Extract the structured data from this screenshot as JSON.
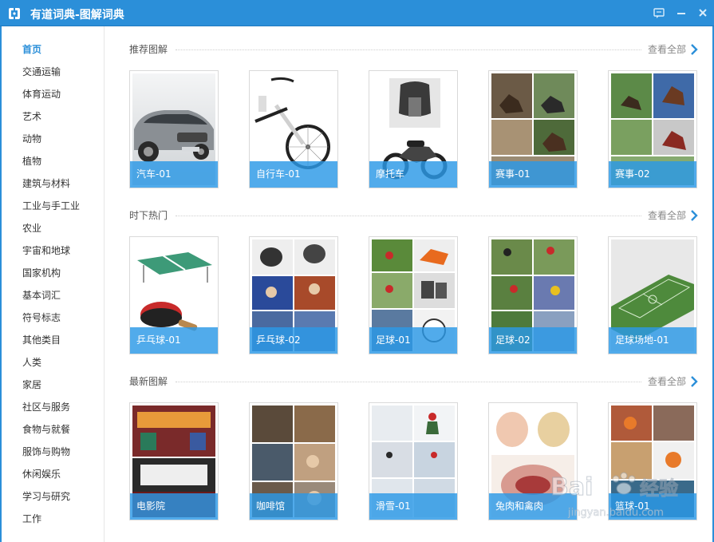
{
  "window": {
    "title": "有道词典-图解词典",
    "logo_icon": "youdao-logo-icon",
    "buttons": [
      "feedback-icon",
      "minimize-icon",
      "close-icon"
    ]
  },
  "sidebar": {
    "items": [
      {
        "label": "首页",
        "active": true
      },
      {
        "label": "交通运输"
      },
      {
        "label": "体育运动"
      },
      {
        "label": "艺术"
      },
      {
        "label": "动物"
      },
      {
        "label": "植物"
      },
      {
        "label": "建筑与材料"
      },
      {
        "label": "工业与手工业"
      },
      {
        "label": "农业"
      },
      {
        "label": "宇宙和地球"
      },
      {
        "label": "国家机构"
      },
      {
        "label": "基本词汇"
      },
      {
        "label": "符号标志"
      },
      {
        "label": "其他类目"
      },
      {
        "label": "人类"
      },
      {
        "label": "家居"
      },
      {
        "label": "社区与服务"
      },
      {
        "label": "食物与就餐"
      },
      {
        "label": "服饰与购物"
      },
      {
        "label": "休闲娱乐"
      },
      {
        "label": "学习与研究"
      },
      {
        "label": "工作"
      }
    ]
  },
  "sections": [
    {
      "title": "推荐图解",
      "view_all": "查看全部",
      "cards": [
        {
          "label": "汽车-01"
        },
        {
          "label": "自行车-01"
        },
        {
          "label": "摩托车"
        },
        {
          "label": "赛事-01"
        },
        {
          "label": "赛事-02"
        }
      ]
    },
    {
      "title": "时下热门",
      "view_all": "查看全部",
      "cards": [
        {
          "label": "乒乓球-01"
        },
        {
          "label": "乒乓球-02"
        },
        {
          "label": "足球-01"
        },
        {
          "label": "足球-02"
        },
        {
          "label": "足球场地-01"
        }
      ]
    },
    {
      "title": "最新图解",
      "view_all": "查看全部",
      "cards": [
        {
          "label": "电影院"
        },
        {
          "label": "咖啡馆"
        },
        {
          "label": "滑雪-01"
        },
        {
          "label": "兔肉和禽肉"
        },
        {
          "label": "篮球-01"
        }
      ]
    }
  ],
  "watermark": {
    "brand": "Bai",
    "brand_suffix": "经验",
    "url": "jingyan.baidu.com"
  },
  "colors": {
    "accent": "#2b8fd9",
    "caption_bg": "#2b99e6"
  }
}
